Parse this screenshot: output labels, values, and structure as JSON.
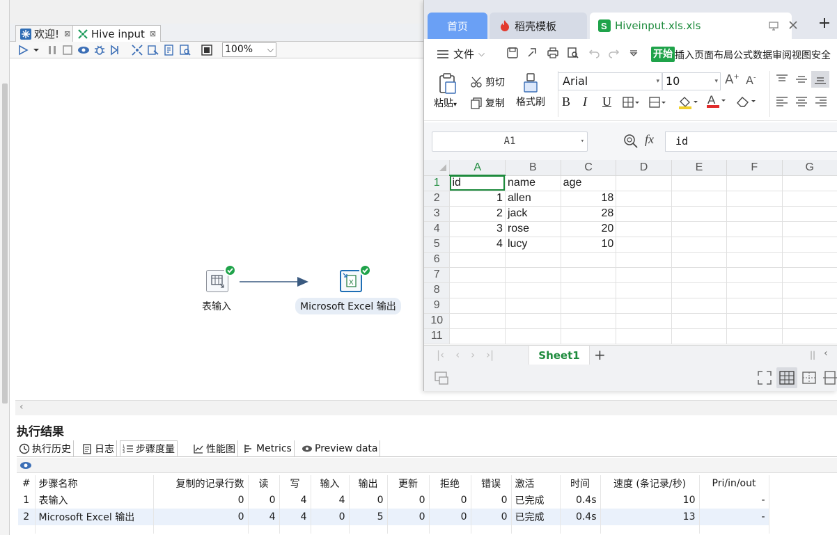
{
  "editor": {
    "tabs": [
      {
        "label": "欢迎!",
        "close": "⊠"
      },
      {
        "label": "Hive input",
        "close": "⊠"
      }
    ],
    "zoom": "100%"
  },
  "canvas": {
    "nodes": [
      {
        "label": "表输入",
        "status": "completed"
      },
      {
        "label": "Microsoft Excel 输出",
        "status": "completed"
      }
    ]
  },
  "results": {
    "title": "执行结果",
    "tabs": [
      "执行历史",
      "日志",
      "步骤度量",
      "性能图",
      "Metrics",
      "Preview data"
    ],
    "active_tab": "步骤度量",
    "columns": [
      "#",
      "步骤名称",
      "复制的记录行数",
      "读",
      "写",
      "输入",
      "输出",
      "更新",
      "拒绝",
      "错误",
      "激活",
      "时间",
      "速度 (条记录/秒)",
      "Pri/in/out"
    ],
    "rows": [
      [
        "1",
        "表输入",
        "0",
        "0",
        "4",
        "4",
        "0",
        "0",
        "0",
        "0",
        "已完成",
        "0.4s",
        "10",
        "-"
      ],
      [
        "2",
        "Microsoft Excel 输出",
        "0",
        "4",
        "4",
        "0",
        "5",
        "0",
        "0",
        "0",
        "已完成",
        "0.4s",
        "13",
        "-"
      ]
    ]
  },
  "spreadsheet": {
    "tabs": {
      "home": "首页",
      "templates": "稻壳模板",
      "file": "Hiveinput.xls.xls"
    },
    "menu": {
      "file": "文件",
      "items": [
        "开始",
        "插入",
        "页面布局",
        "公式",
        "数据",
        "审阅",
        "视图",
        "安全"
      ]
    },
    "ribbon": {
      "paste": "粘贴",
      "cut": "剪切",
      "copy": "复制",
      "format_painter": "格式刷",
      "font": "Arial",
      "font_size": "10",
      "bold": "B",
      "italic": "I",
      "underline": "U"
    },
    "name_box": "A1",
    "fx": "fx",
    "formula_value": "id",
    "columns": [
      "A",
      "B",
      "C",
      "D",
      "E",
      "F",
      "G"
    ],
    "rows": [
      [
        "id",
        "name",
        "age"
      ],
      [
        "1",
        "allen",
        "18"
      ],
      [
        "2",
        "jack",
        "28"
      ],
      [
        "3",
        "rose",
        "20"
      ],
      [
        "4",
        "lucy",
        "10"
      ],
      [],
      [],
      [],
      [],
      [],
      []
    ],
    "row_numbers": [
      "1",
      "2",
      "3",
      "4",
      "5",
      "6",
      "7",
      "8",
      "9",
      "10",
      "11"
    ],
    "sheet_name": "Sheet1",
    "add_sheet": "+"
  },
  "colors": {
    "accent_green": "#1e8b3d",
    "home_tab_blue": "#6aa0f5",
    "status_green": "#1fa34a"
  }
}
